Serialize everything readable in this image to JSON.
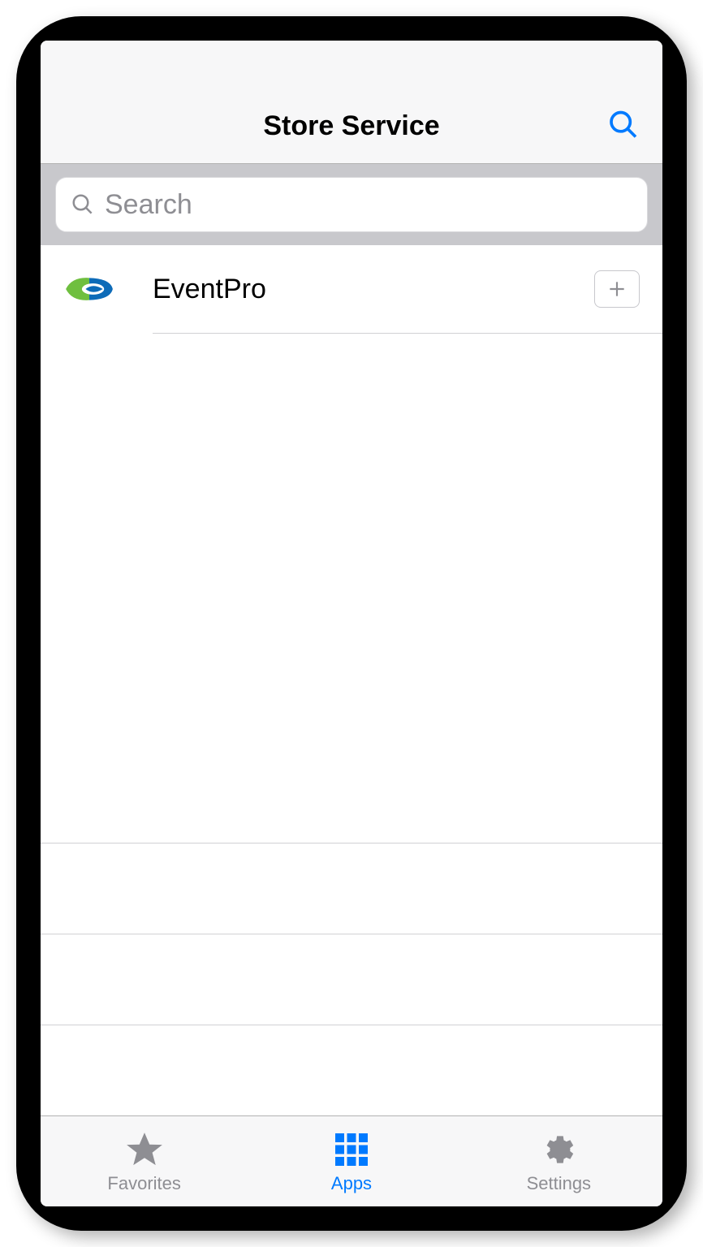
{
  "header": {
    "title": "Store Service"
  },
  "search": {
    "placeholder": "Search"
  },
  "apps": [
    {
      "name": "EventPro"
    }
  ],
  "tabs": {
    "favorites": "Favorites",
    "apps": "Apps",
    "settings": "Settings"
  }
}
